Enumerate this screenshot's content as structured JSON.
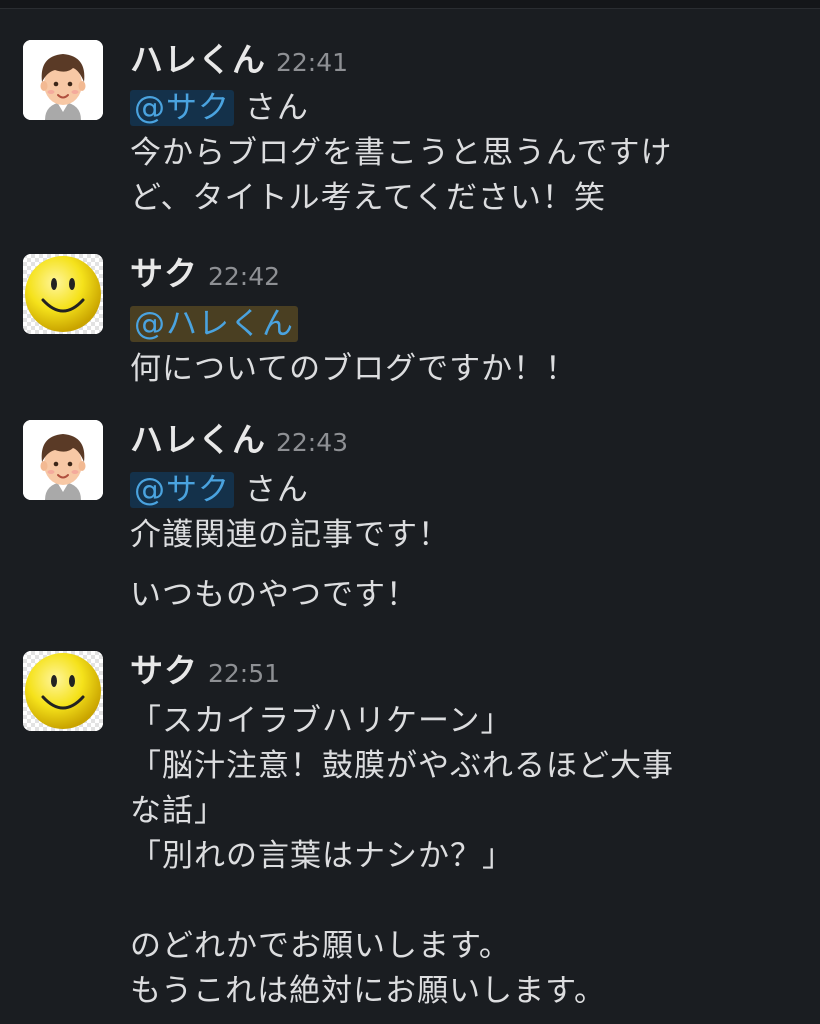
{
  "messages": [
    {
      "sender": "ハレくん",
      "avatar_icon": "boy-avatar-icon",
      "time": "22:41",
      "mention": "@サク",
      "mention_suffix": " さん",
      "lines": [
        "今からブログを書こうと思うんですけ",
        "ど、タイトル考えてください！笑"
      ]
    },
    {
      "sender": "サク",
      "avatar_icon": "smiley-avatar-icon",
      "time": "22:42",
      "mention": "@ハレくん",
      "lines": [
        "何についてのブログですか！！"
      ]
    },
    {
      "sender": "ハレくん",
      "avatar_icon": "boy-avatar-icon",
      "time": "22:43",
      "mention": "@サク",
      "mention_suffix": " さん",
      "lines": [
        "介護関連の記事です！",
        "いつものやつです！"
      ]
    },
    {
      "sender": "サク",
      "avatar_icon": "smiley-avatar-icon",
      "time": "22:51",
      "lines": [
        "「スカイラブハリケーン」",
        "「脳汁注意！鼓膜がやぶれるほど大事",
        "な話」",
        "「別れの言葉はナシか？」",
        "のどれかでお願いします。",
        "もうこれは絶対にお願いします。"
      ]
    }
  ],
  "colors": {
    "background": "#1a1d21",
    "mention_text": "#4aa3df",
    "mention_bg": "#14314a",
    "self_mention_bg": "#4a3f22"
  }
}
